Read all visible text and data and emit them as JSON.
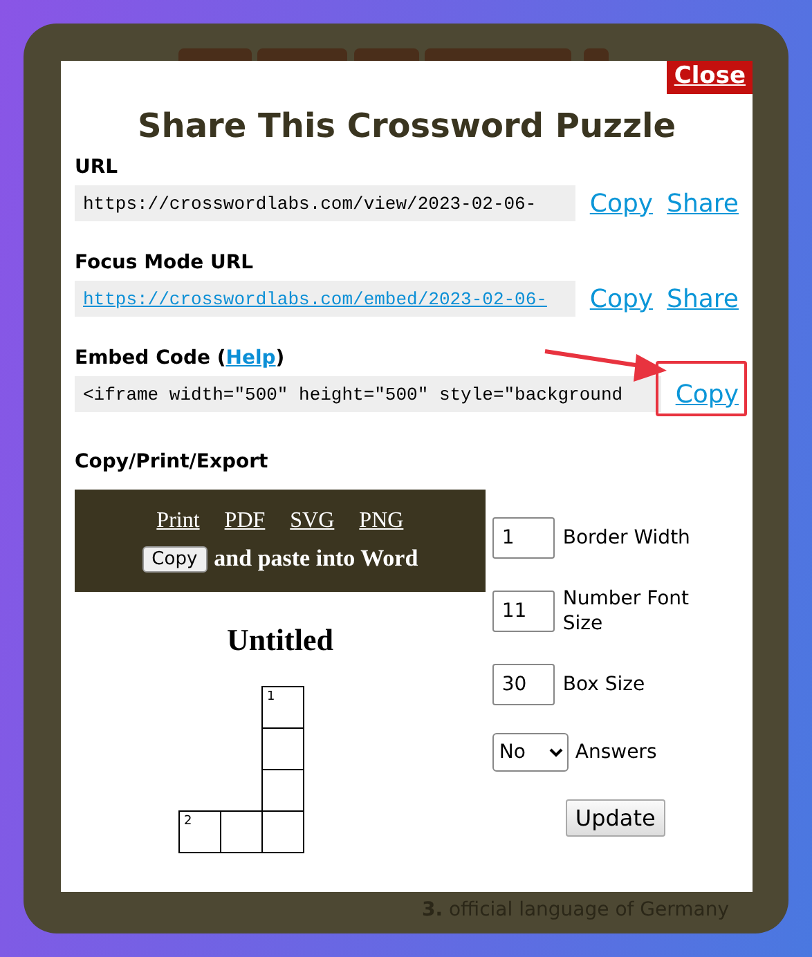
{
  "close_button": "Close",
  "title": "Share This Crossword Puzzle",
  "links": [
    {
      "label": "URL",
      "value": "https://crosswordlabs.com/view/2023-02-06-",
      "kind": "plain",
      "actions": [
        "Copy",
        "Share"
      ]
    },
    {
      "label": "Focus Mode URL",
      "value": "https://crosswordlabs.com/embed/2023-02-06-",
      "kind": "link",
      "actions": [
        "Copy",
        "Share"
      ]
    },
    {
      "label": "Embed Code (",
      "help": "Help",
      "label_end": ")",
      "value": "<iframe width=\"500\" height=\"500\" style=\"background",
      "kind": "plain",
      "actions": [
        "Copy"
      ],
      "highlighted": true
    }
  ],
  "export": {
    "heading": "Copy/Print/Export",
    "formats": [
      "Print",
      "PDF",
      "SVG",
      "PNG"
    ],
    "copy_button": "Copy",
    "copy_note": "and paste into Word"
  },
  "preview": {
    "title": "Untitled",
    "grid": [
      [
        {
          "kind": "blank"
        },
        {
          "kind": "blank"
        },
        {
          "kind": "square",
          "number": "1"
        }
      ],
      [
        {
          "kind": "blank"
        },
        {
          "kind": "blank"
        },
        {
          "kind": "square"
        }
      ],
      [
        {
          "kind": "blank"
        },
        {
          "kind": "blank"
        },
        {
          "kind": "square"
        }
      ],
      [
        {
          "kind": "square",
          "number": "2"
        },
        {
          "kind": "square"
        },
        {
          "kind": "square"
        }
      ]
    ]
  },
  "options": [
    {
      "kind": "input",
      "value": "1",
      "label": "Border Width"
    },
    {
      "kind": "input",
      "value": "11",
      "label": "Number Font Size"
    },
    {
      "kind": "input",
      "value": "30",
      "label": "Box Size"
    },
    {
      "kind": "select",
      "value": "No",
      "label": "Answers"
    }
  ],
  "update_button": "Update",
  "behind": {
    "clue_number": "3.",
    "clue": "official language of Germany"
  }
}
